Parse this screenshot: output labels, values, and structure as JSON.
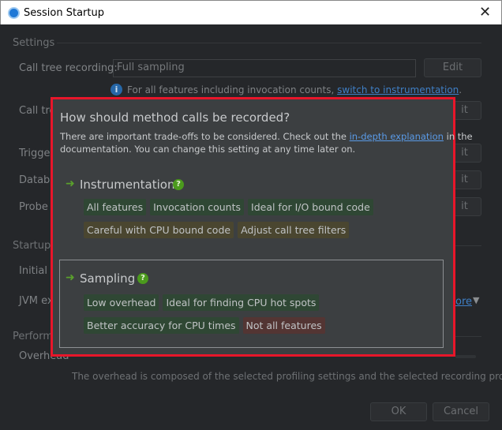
{
  "window": {
    "title": "Session Startup",
    "close_icon": "close-icon",
    "app_icon": "jprofiler-icon"
  },
  "settings": {
    "header": "Settings",
    "call_tree_label": "Call tree recording:",
    "call_tree_value": "Full sampling",
    "edit_label": "Edit",
    "info_text": "For all features including invocation counts, ",
    "info_link": "switch to instrumentation",
    "info_end": ".",
    "hidden_labels": [
      "Call tre",
      "Trigge",
      "Databa",
      "Probe "
    ]
  },
  "startup": {
    "header": "Startup",
    "labels": [
      "Initial r",
      "JVM ex"
    ],
    "more_link": "ore"
  },
  "performance": {
    "header": "Perform",
    "overhead_label": "Overhead",
    "note": "The overhead is composed of the selected profiling settings and the selected recording profile."
  },
  "footer": {
    "ok": "OK",
    "cancel": "Cancel"
  },
  "popup": {
    "title": "How should method calls be recorded?",
    "desc1": "There are important trade-offs to be considered. Check out the ",
    "desc_link": "in-depth explanation",
    "desc2": " in the",
    "desc3": "documentation. You can change this setting at any time later on.",
    "instrumentation": {
      "label": "Instrumentation",
      "help": "?",
      "tags": [
        {
          "text": "All features",
          "kind": "pro"
        },
        {
          "text": "Invocation counts",
          "kind": "pro"
        },
        {
          "text": "Ideal for I/O bound code",
          "kind": "pro"
        },
        {
          "text": "Careful with CPU bound code",
          "kind": "caution"
        },
        {
          "text": "Adjust call tree filters",
          "kind": "caution"
        }
      ]
    },
    "sampling": {
      "label": "Sampling",
      "help": "?",
      "selected": true,
      "tags": [
        {
          "text": "Low overhead",
          "kind": "pro"
        },
        {
          "text": "Ideal for finding CPU hot spots",
          "kind": "pro"
        },
        {
          "text": "Better accuracy for CPU times",
          "kind": "pro"
        },
        {
          "text": "Not all features",
          "kind": "con"
        }
      ]
    },
    "highlight_color": "#e8162a"
  }
}
